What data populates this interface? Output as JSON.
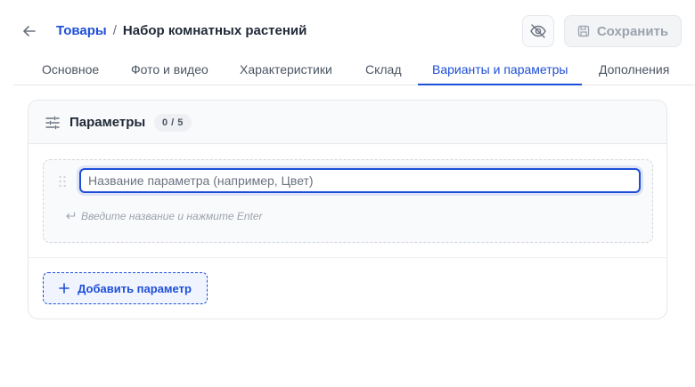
{
  "header": {
    "breadcrumb": {
      "parent": "Товары",
      "separator": "/",
      "current": "Набор комнатных растений"
    },
    "visibility_icon": "eye-off-icon",
    "save_label": "Сохранить"
  },
  "tabs": [
    {
      "label": "Основное",
      "active": false
    },
    {
      "label": "Фото и видео",
      "active": false
    },
    {
      "label": "Характеристики",
      "active": false
    },
    {
      "label": "Склад",
      "active": false
    },
    {
      "label": "Варианты и параметры",
      "active": true
    },
    {
      "label": "Дополнения",
      "active": false
    }
  ],
  "parameters_card": {
    "title": "Параметры",
    "count": "0 / 5",
    "input_placeholder": "Название параметра (например, Цвет)",
    "input_value": "",
    "hint": "Введите название и нажмите Enter",
    "add_button_label": "Добавить параметр"
  },
  "colors": {
    "accent": "#1d4ed8",
    "muted_text": "#9ca3af"
  }
}
